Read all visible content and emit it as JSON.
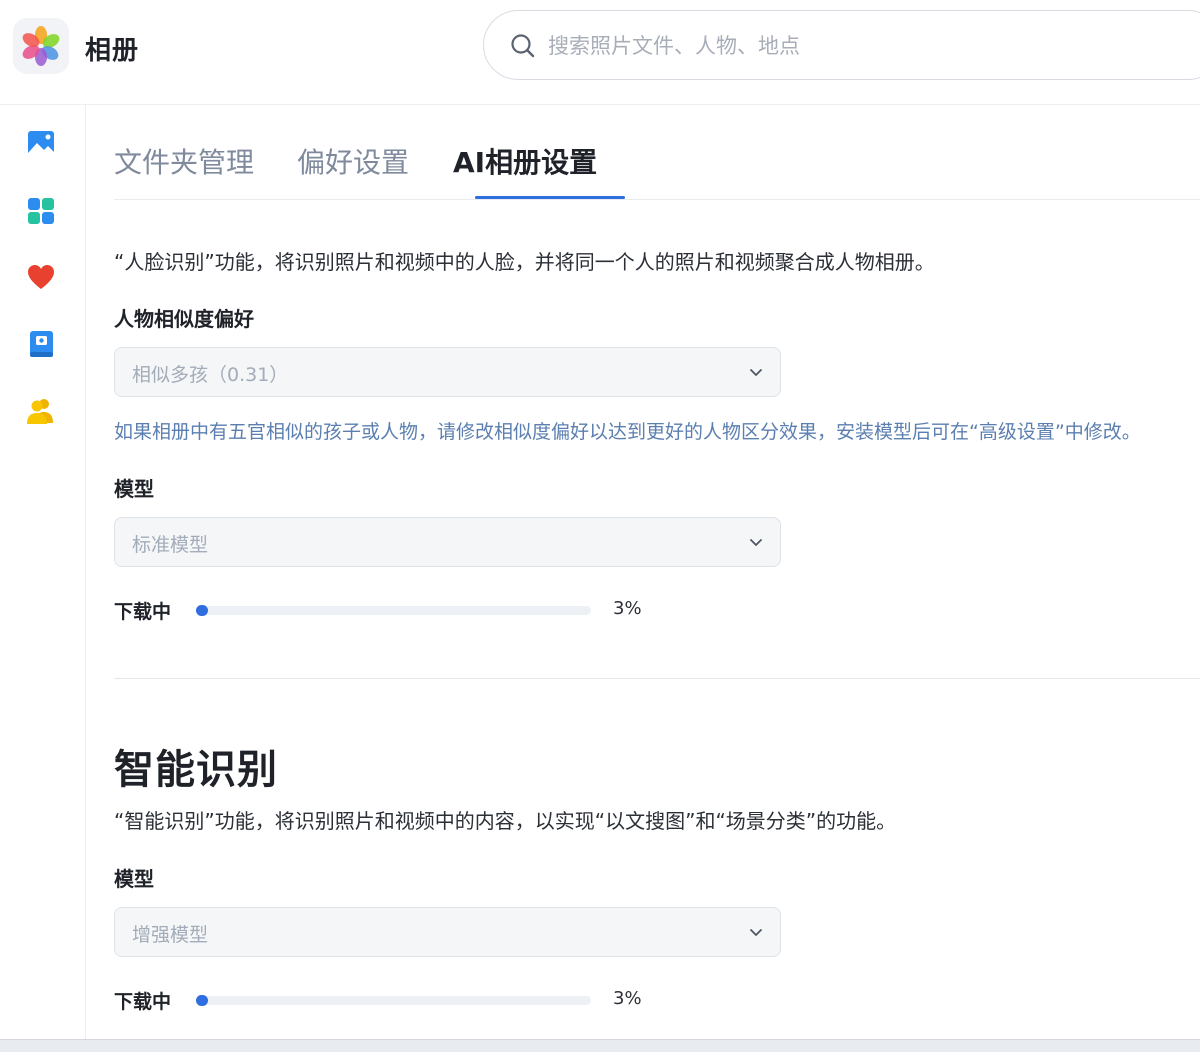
{
  "app": {
    "title": "相册"
  },
  "search": {
    "placeholder": "搜索照片文件、人物、地点"
  },
  "sidebar": {
    "items": [
      {
        "name": "photos",
        "icon": "photo-icon"
      },
      {
        "name": "albums",
        "icon": "grid-icon"
      },
      {
        "name": "favorites",
        "icon": "heart-icon"
      },
      {
        "name": "memories",
        "icon": "book-icon"
      },
      {
        "name": "people",
        "icon": "people-icon"
      }
    ]
  },
  "tabs": [
    {
      "label": "文件夹管理",
      "active": false
    },
    {
      "label": "偏好设置",
      "active": false
    },
    {
      "label": "AI相册设置",
      "active": true
    }
  ],
  "face": {
    "description": "“人脸识别”功能，将识别照片和视频中的人脸，并将同一个人的照片和视频聚合成人物相册。",
    "similarity_label": "人物相似度偏好",
    "similarity_value": "相似多孩（0.31）",
    "hint": "如果相册中有五官相似的孩子或人物，请修改相似度偏好以达到更好的人物区分效果，安装模型后可在“高级设置”中修改。",
    "model_label": "模型",
    "model_value": "标准模型",
    "download_label": "下载中",
    "download_percent": "3%",
    "download_fraction": 0.03
  },
  "smart": {
    "title": "智能识别",
    "description": "“智能识别”功能，将识别照片和视频中的内容，以实现“以文搜图”和“场景分类”的功能。",
    "model_label": "模型",
    "model_value": "增强模型",
    "download_label": "下载中",
    "download_percent": "3%",
    "download_fraction": 0.03
  },
  "colors": {
    "accent": "#2f6ee0",
    "hint_text": "#5b7fb0",
    "inactive_tab": "#7f8a9c"
  }
}
